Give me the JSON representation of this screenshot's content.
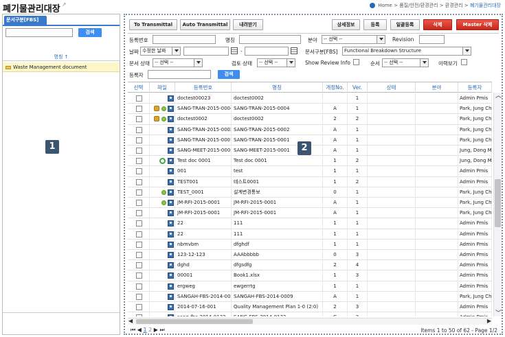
{
  "page": {
    "title": "폐기물관리대장",
    "title_ext": "↗",
    "breadcrumb": {
      "home": "Home",
      "sep": ">",
      "path1": "품질/안전/환경관리",
      "path2": "환경관리",
      "current": "폐기물관리대장"
    }
  },
  "left_panel": {
    "tab_label": "문서구분[FBS]",
    "search_button": "검색",
    "column_header": "명칭",
    "sort_marker": "↑",
    "tree_items": [
      "Waste Management document"
    ],
    "badge": "1"
  },
  "toolbar": {
    "to_transmittal": "To Transmittal",
    "auto_transmittal": "Auto Transmittal",
    "download": "내려받기",
    "detail_info": "상세정보",
    "register": "등록",
    "bulk_register": "일괄등록",
    "delete": "삭제",
    "master_delete": "Master 삭제"
  },
  "filters": {
    "reg_no_label": "등록번호",
    "name_label": "명칭",
    "field_label": "분야",
    "field_value": "-- 선택 --",
    "revision_label": "Revision",
    "date_label": "날짜",
    "date_type_value": "수정한 날짜",
    "date_sep": "-",
    "doc_class_label": "문서구분[FBS]",
    "doc_class_value": "Functional Breakdown Structure",
    "doc_status_label": "문서 상태",
    "doc_status_value": "-- 선택 --",
    "review_status_label": "검토 상태",
    "review_status_value": "-- 선택 --",
    "show_review_label": "Show Review Info",
    "order_label": "순서",
    "order_value": "-- 선택 --",
    "history_label": "이력보기",
    "registrant_label": "등록자",
    "search_button": "검색"
  },
  "grid": {
    "columns": [
      "선택",
      "파일",
      "등록번호",
      "명칭",
      "개정No.",
      "Ver.",
      "상태",
      "분야",
      "등록자"
    ],
    "rows": [
      {
        "reg": "doctest00023",
        "name": "doctest0002",
        "rev": "",
        "ver": "1",
        "user": "Admin Pmis",
        "lock": false,
        "dot": false,
        "refresh": false
      },
      {
        "reg": "SANG-TRAN-2015-0004",
        "name": "SANG-TRAN-2015-0004",
        "rev": "A",
        "ver": "1",
        "user": "Park, Jung Ch",
        "lock": true,
        "dot": true,
        "refresh": false
      },
      {
        "reg": "doctest0002",
        "name": "doctest0002",
        "rev": "2",
        "ver": "2",
        "user": "Park, Jung Ch",
        "lock": true,
        "dot": true,
        "refresh": false
      },
      {
        "reg": "SANG-TRAN-2015-0002",
        "name": "SANG-TRAN-2015-0002",
        "rev": "A",
        "ver": "1",
        "user": "Park, Jung Ch",
        "lock": false,
        "dot": false,
        "refresh": false
      },
      {
        "reg": "SANG-TRAN-2015-0001",
        "name": "SANG-TRAN-2015-0001",
        "rev": "A",
        "ver": "1",
        "user": "Park, Jung Ch",
        "lock": false,
        "dot": false,
        "refresh": false
      },
      {
        "reg": "SANG-MEET-2015-0001",
        "name": "SANG-MEET-2015-0001",
        "rev": "A",
        "ver": "1",
        "user": "Jung, Dong M",
        "lock": false,
        "dot": false,
        "refresh": false
      },
      {
        "reg": "Test doc 0001",
        "name": "Test doc 0001",
        "rev": "1",
        "ver": "2",
        "user": "Jung, Dong M",
        "lock": false,
        "dot": false,
        "refresh": true
      },
      {
        "reg": "001",
        "name": "test",
        "rev": "1",
        "ver": "1",
        "user": "Admin Pmis",
        "lock": false,
        "dot": false,
        "refresh": false
      },
      {
        "reg": "TEST001",
        "name": "테스트0001",
        "rev": "1",
        "ver": "2",
        "user": "Admin Pmis",
        "lock": false,
        "dot": false,
        "refresh": false
      },
      {
        "reg": "TEST_0001",
        "name": "설계변경통보",
        "rev": "0",
        "ver": "1",
        "user": "Park, Jung Ch",
        "lock": false,
        "dot": true,
        "refresh": false
      },
      {
        "reg": "JM-RFI-2015-0001",
        "name": "JM-RFI-2015-0001",
        "rev": "A",
        "ver": "1",
        "user": "Park, Jung Ch",
        "lock": false,
        "dot": true,
        "refresh": false
      },
      {
        "reg": "JM-RFI-2015-0001",
        "name": "JM-RFI-2015-0001",
        "rev": "A",
        "ver": "1",
        "user": "Park, Jung Ch",
        "lock": false,
        "dot": false,
        "refresh": false
      },
      {
        "reg": "22",
        "name": "111",
        "rev": "1",
        "ver": "1",
        "user": "Admin Pmis",
        "lock": false,
        "dot": false,
        "refresh": false
      },
      {
        "reg": "22",
        "name": "111",
        "rev": "1",
        "ver": "1",
        "user": "Admin Pmis",
        "lock": false,
        "dot": false,
        "refresh": false
      },
      {
        "reg": "nbmvbm",
        "name": "dfghdf",
        "rev": "1",
        "ver": "1",
        "user": "Admin Pmis",
        "lock": false,
        "dot": false,
        "refresh": false
      },
      {
        "reg": "123-12-123",
        "name": "AAAbbbbb",
        "rev": "0",
        "ver": "3",
        "user": "Admin Pmis",
        "lock": false,
        "dot": false,
        "refresh": false
      },
      {
        "reg": "dghd",
        "name": "dfgsdfg",
        "rev": "2",
        "ver": "4",
        "user": "Admin Pmis",
        "lock": false,
        "dot": false,
        "refresh": false
      },
      {
        "reg": "00001",
        "name": "Book1.xlsx",
        "rev": "1",
        "ver": "3",
        "user": "Admin Pmis",
        "lock": false,
        "dot": false,
        "refresh": false
      },
      {
        "reg": "ergweg",
        "name": "ewgerrtg",
        "rev": "1",
        "ver": "1",
        "user": "Admin Pmis",
        "lock": false,
        "dot": false,
        "refresh": false
      },
      {
        "reg": "SANGAH-FBS-2014-0009",
        "name": "SANGAH-FBS-2014-0009",
        "rev": "A",
        "ver": "1",
        "user": "Park, Jung Ch",
        "lock": false,
        "dot": false,
        "refresh": false
      },
      {
        "reg": "2014-07-16-001",
        "name": "Quality Management Plan 1-0 (2:0)",
        "rev": "2",
        "ver": "3",
        "user": "Admin Pmis",
        "lock": false,
        "dot": false,
        "refresh": false
      },
      {
        "reg": "sang-fbs-2014-0132",
        "name": "SANG-FBS-2014-0132",
        "rev": "C",
        "ver": "3",
        "user": "Admin Pmis",
        "lock": false,
        "dot": false,
        "refresh": false
      }
    ]
  },
  "pager": {
    "first": "⏮",
    "prev": "◀",
    "page1": "1",
    "page2": "2",
    "next": "▶",
    "last": "⏭",
    "items": "Items 1 to 50 of 62 - Page 1/2"
  },
  "badge_right": "2",
  "colors": {
    "accent": "#3a78c9",
    "button_blue": "#3d8ef0",
    "danger": "#c7281a"
  }
}
